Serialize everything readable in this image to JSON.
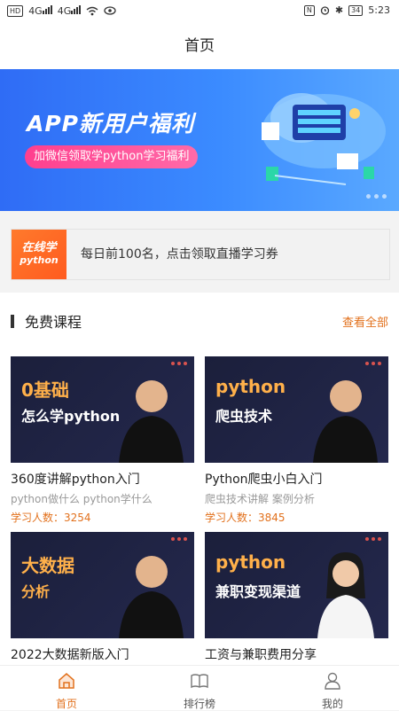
{
  "status_bar": {
    "left": "HD",
    "signal1": "4G",
    "signal2": "4G",
    "battery": "34",
    "time": "5:23"
  },
  "header": {
    "title": "首页"
  },
  "banner": {
    "title": "APP新用户福利",
    "pill": "加微信领取学python学习福利"
  },
  "notice": {
    "logo_line1": "在线学",
    "logo_line2": "python",
    "text": "每日前100名，点击领取直播学习券"
  },
  "section": {
    "title": "免费课程",
    "more": "查看全部"
  },
  "courses": [
    {
      "thumb_line1": "0基础",
      "thumb_line2": "怎么学python",
      "name": "360度讲解python入门",
      "tags": "python做什么 python学什么",
      "count": "学习人数：3254"
    },
    {
      "thumb_line1": "python",
      "thumb_line2": "爬虫技术",
      "name": "Python爬虫小白入门",
      "tags": "爬虫技术讲解 案例分析",
      "count": "学习人数：3845"
    },
    {
      "thumb_line1": "大数据",
      "thumb_line2": "分析",
      "name": "2022大数据新版入门",
      "tags": "",
      "count": ""
    },
    {
      "thumb_line1": "python",
      "thumb_line2": "兼职变现渠道",
      "name": "工资与兼职费用分享",
      "tags": "",
      "count": ""
    }
  ],
  "tabs": [
    {
      "label": "首页",
      "icon": "home-icon"
    },
    {
      "label": "排行榜",
      "icon": "book-icon"
    },
    {
      "label": "我的",
      "icon": "user-icon"
    }
  ],
  "colors": {
    "accent": "#e2711d",
    "banner": "#3b8bff",
    "pill": "#ff4f96",
    "card_bg": "#1b1f3b"
  }
}
